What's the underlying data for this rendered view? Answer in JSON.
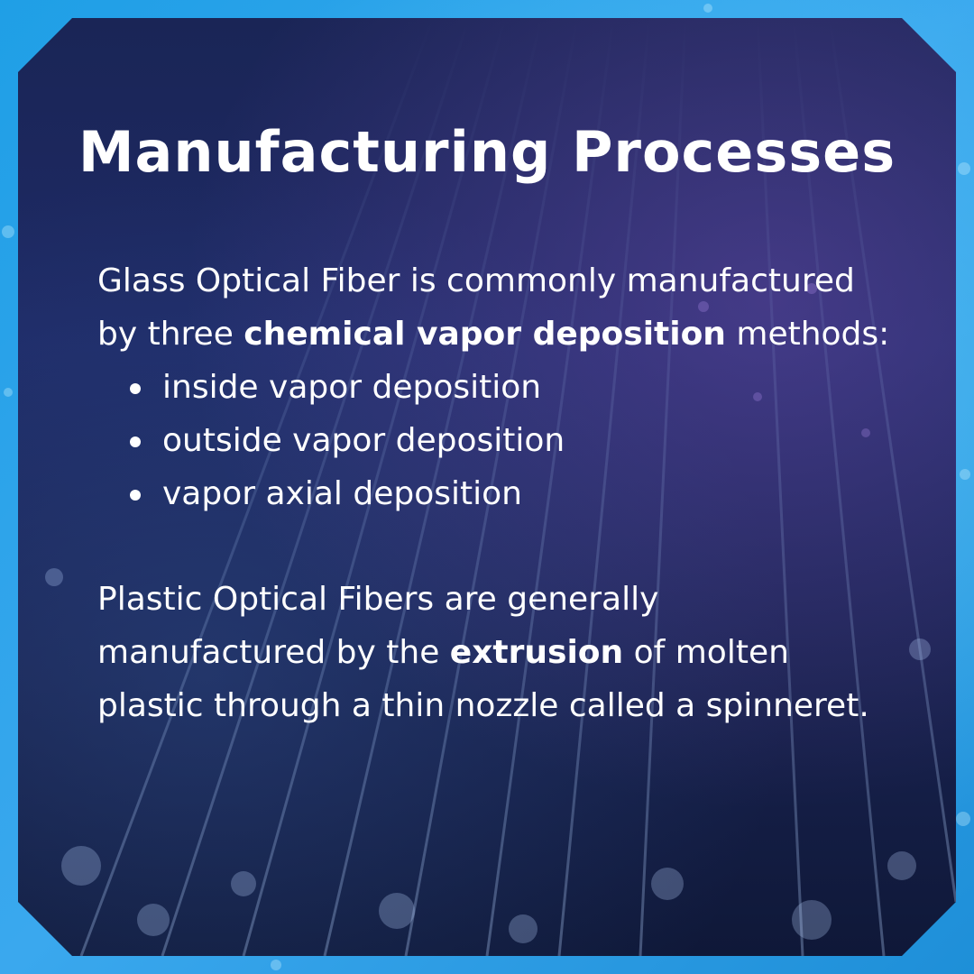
{
  "title": "Manufacturing Processes",
  "glass": {
    "intro_before": "Glass Optical Fiber is commonly manufactured by three ",
    "intro_bold": "chemical vapor deposition",
    "intro_after": " methods:",
    "methods": [
      "inside vapor deposition",
      "outside vapor deposition",
      "vapor axial deposition"
    ]
  },
  "plastic": {
    "text_before": "Plastic Optical Fibers are generally manufactured by the ",
    "text_bold": "extrusion",
    "text_after": " of molten plastic through a thin nozzle called a spinneret."
  },
  "colors": {
    "frame": "#2aa3ea",
    "card": "#1c2760",
    "text": "#ffffff"
  }
}
